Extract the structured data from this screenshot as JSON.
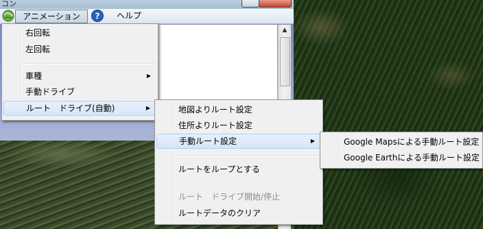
{
  "window": {
    "title_partial": "コン"
  },
  "menubar": {
    "animation_label": "アニメーション",
    "help_label": "ヘルプ",
    "icons": [
      "app-globe-icon",
      "help-icon"
    ]
  },
  "animation_menu": {
    "rotate_right": "右回転",
    "rotate_left": "左回転",
    "vehicle_type": "車種",
    "manual_drive": "手動ドライブ",
    "route_drive_auto": "ルート　ドライブ(自動)"
  },
  "route_menu": {
    "from_map": "地図よりルート設定",
    "from_address": "住所よりルート設定",
    "manual_route": "手動ルート設定",
    "loop_route": "ルートをループとする",
    "start_stop": "ルート　ドライブ開始/停止",
    "clear_data": "ルートデータのクリア"
  },
  "manual_route_menu": {
    "google_maps": "Google Mapsによる手動ルート設定",
    "google_earth": "Google Earthによる手動ルート設定"
  },
  "colors": {
    "menu_bg": "#f0f0f0",
    "highlight": "#d6e6f8",
    "highlight_border": "#aecff7",
    "disabled_text": "#8d8d8d",
    "help_icon_blue": "#2a5fb8"
  }
}
